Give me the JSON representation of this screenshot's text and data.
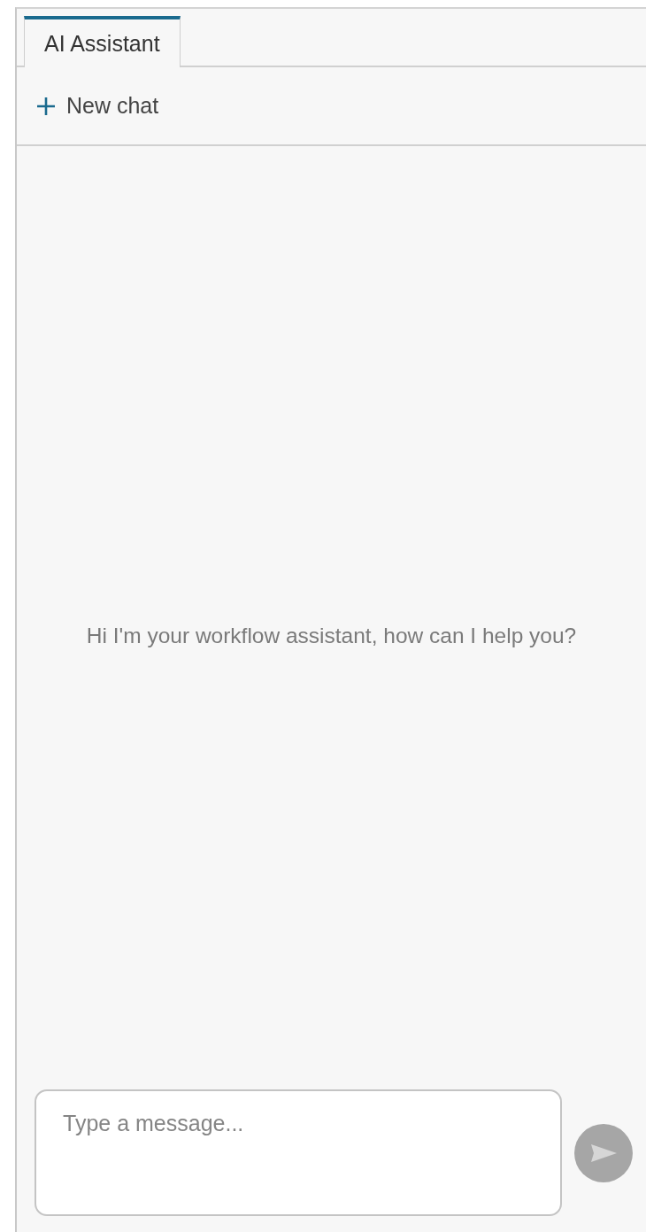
{
  "tabs": [
    {
      "label": "AI Assistant",
      "selected": true
    }
  ],
  "toolbar": {
    "new_chat": "New chat"
  },
  "greeting": "Hi I'm your workflow assistant, how can I help you?",
  "composer": {
    "placeholder": "Type a message...",
    "send_disabled": true
  }
}
